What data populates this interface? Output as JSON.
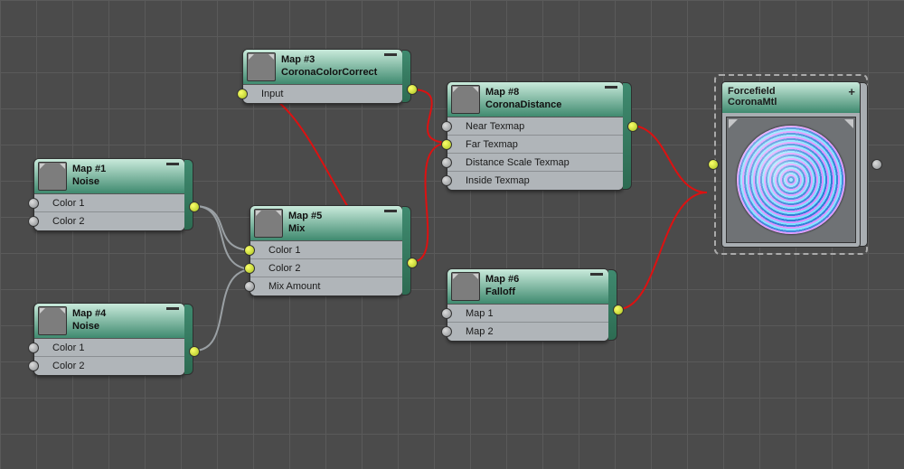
{
  "nodes": {
    "map1": {
      "title": "Map #1",
      "type": "Noise",
      "swatch": "gray",
      "rows": [
        "Color 1",
        "Color 2"
      ]
    },
    "map4": {
      "title": "Map #4",
      "type": "Noise",
      "swatch": "gray",
      "rows": [
        "Color 1",
        "Color 2"
      ]
    },
    "map3": {
      "title": "Map #3",
      "type": "CoronaColorCorrect",
      "swatch": "black",
      "rows": [
        "Input"
      ]
    },
    "map5": {
      "title": "Map #5",
      "type": "Mix",
      "swatch": "gray",
      "rows": [
        "Color 1",
        "Color 2",
        "Mix Amount"
      ]
    },
    "map8": {
      "title": "Map #8",
      "type": "CoronaDistance",
      "swatch": "black",
      "rows": [
        "Near Texmap",
        "Far Texmap",
        "Distance Scale Texmap",
        "Inside Texmap"
      ]
    },
    "map6": {
      "title": "Map #6",
      "type": "Falloff",
      "swatch": "cyan",
      "rows": [
        "Map 1",
        "Map 2"
      ]
    }
  },
  "material": {
    "title": "Forcefield",
    "type": "CoronaMtl"
  }
}
